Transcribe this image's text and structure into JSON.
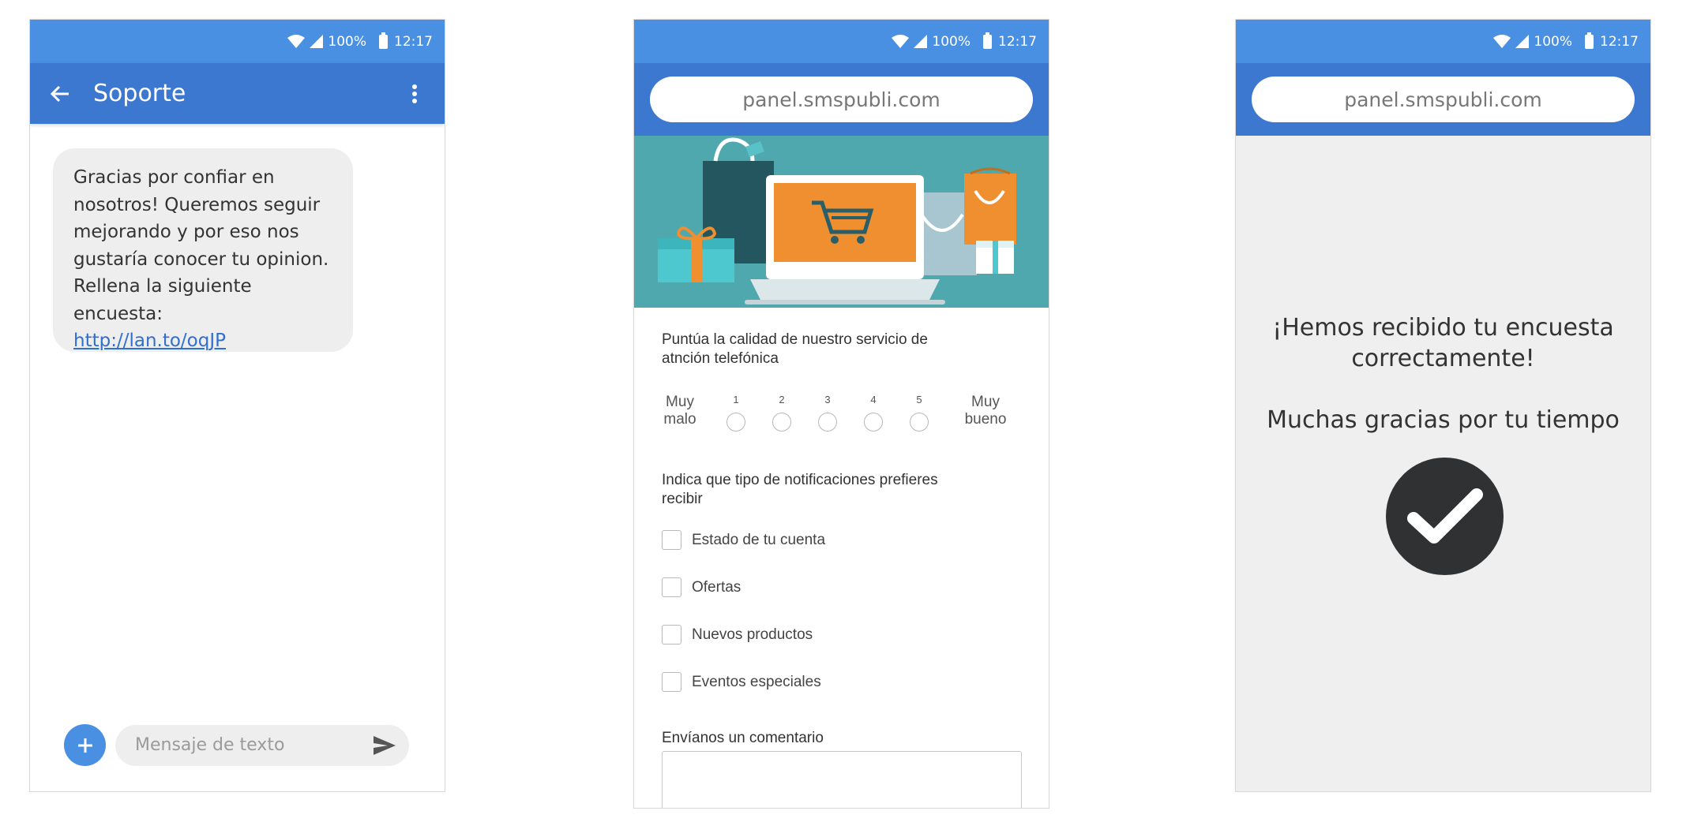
{
  "status_bar": {
    "battery": "100%",
    "time": "12:17"
  },
  "sms": {
    "title": "Soporte",
    "message_lines": [
      "Gracias por confiar en",
      "nosotros! Queremos seguir",
      "mejorando y por eso nos",
      "gustaría conocer tu opinion.",
      "Rellena la siguiente encuesta:"
    ],
    "link": "http://lan.to/oqJP",
    "composer_placeholder": "Mensaje de texto"
  },
  "survey": {
    "url": "panel.smspubli.com",
    "q1": [
      "Puntúa la calidad de nuestro servicio de",
      "atnción telefónica"
    ],
    "scale": {
      "low": [
        "Muy",
        "malo"
      ],
      "high": [
        "Muy",
        "bueno"
      ],
      "numbers": [
        "1",
        "2",
        "3",
        "4",
        "5"
      ]
    },
    "q2": [
      "Indica que tipo de notificaciones prefieres",
      "recibir"
    ],
    "options": [
      "Estado de tu cuenta",
      "Ofertas",
      "Nuevos productos",
      "Eventos especiales"
    ],
    "comment_label": "Envíanos un comentario"
  },
  "confirmation": {
    "url": "panel.smspubli.com",
    "line1": "¡Hemos recibido tu encuesta",
    "line2": "correctamente!",
    "line3": "Muchas gracias por tu tiempo"
  },
  "colors": {
    "statusbar": "#4a90e2",
    "toolbar": "#3c78cf",
    "hero_bg": "#4fa8ae",
    "accent_orange": "#ef8f2f"
  },
  "icons": [
    "wifi-icon",
    "signal-icon",
    "battery-icon",
    "back-arrow-icon",
    "more-vert-icon",
    "plus-icon",
    "send-icon",
    "checkmark-icon"
  ]
}
